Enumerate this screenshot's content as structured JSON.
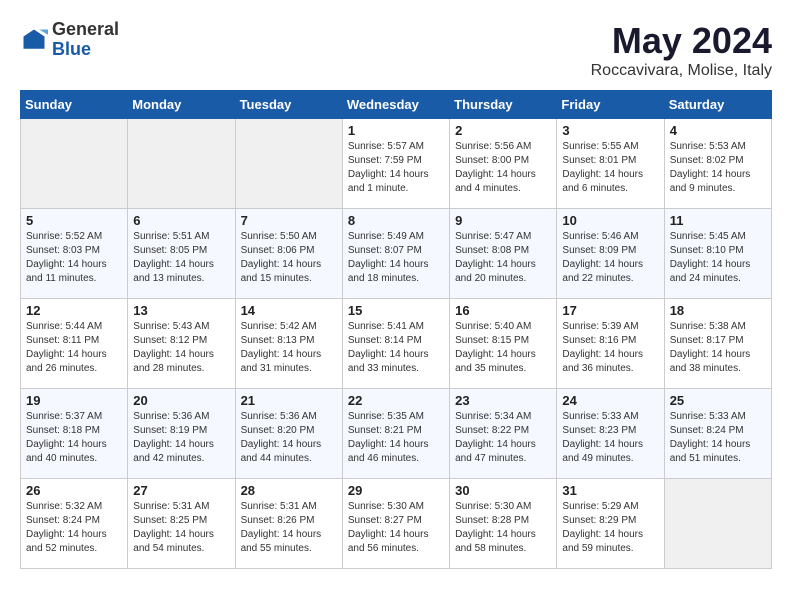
{
  "logo": {
    "general": "General",
    "blue": "Blue"
  },
  "title": "May 2024",
  "location": "Roccavivara, Molise, Italy",
  "days_header": [
    "Sunday",
    "Monday",
    "Tuesday",
    "Wednesday",
    "Thursday",
    "Friday",
    "Saturday"
  ],
  "weeks": [
    [
      {
        "day": "",
        "content": ""
      },
      {
        "day": "",
        "content": ""
      },
      {
        "day": "",
        "content": ""
      },
      {
        "day": "1",
        "content": "Sunrise: 5:57 AM\nSunset: 7:59 PM\nDaylight: 14 hours\nand 1 minute."
      },
      {
        "day": "2",
        "content": "Sunrise: 5:56 AM\nSunset: 8:00 PM\nDaylight: 14 hours\nand 4 minutes."
      },
      {
        "day": "3",
        "content": "Sunrise: 5:55 AM\nSunset: 8:01 PM\nDaylight: 14 hours\nand 6 minutes."
      },
      {
        "day": "4",
        "content": "Sunrise: 5:53 AM\nSunset: 8:02 PM\nDaylight: 14 hours\nand 9 minutes."
      }
    ],
    [
      {
        "day": "5",
        "content": "Sunrise: 5:52 AM\nSunset: 8:03 PM\nDaylight: 14 hours\nand 11 minutes."
      },
      {
        "day": "6",
        "content": "Sunrise: 5:51 AM\nSunset: 8:05 PM\nDaylight: 14 hours\nand 13 minutes."
      },
      {
        "day": "7",
        "content": "Sunrise: 5:50 AM\nSunset: 8:06 PM\nDaylight: 14 hours\nand 15 minutes."
      },
      {
        "day": "8",
        "content": "Sunrise: 5:49 AM\nSunset: 8:07 PM\nDaylight: 14 hours\nand 18 minutes."
      },
      {
        "day": "9",
        "content": "Sunrise: 5:47 AM\nSunset: 8:08 PM\nDaylight: 14 hours\nand 20 minutes."
      },
      {
        "day": "10",
        "content": "Sunrise: 5:46 AM\nSunset: 8:09 PM\nDaylight: 14 hours\nand 22 minutes."
      },
      {
        "day": "11",
        "content": "Sunrise: 5:45 AM\nSunset: 8:10 PM\nDaylight: 14 hours\nand 24 minutes."
      }
    ],
    [
      {
        "day": "12",
        "content": "Sunrise: 5:44 AM\nSunset: 8:11 PM\nDaylight: 14 hours\nand 26 minutes."
      },
      {
        "day": "13",
        "content": "Sunrise: 5:43 AM\nSunset: 8:12 PM\nDaylight: 14 hours\nand 28 minutes."
      },
      {
        "day": "14",
        "content": "Sunrise: 5:42 AM\nSunset: 8:13 PM\nDaylight: 14 hours\nand 31 minutes."
      },
      {
        "day": "15",
        "content": "Sunrise: 5:41 AM\nSunset: 8:14 PM\nDaylight: 14 hours\nand 33 minutes."
      },
      {
        "day": "16",
        "content": "Sunrise: 5:40 AM\nSunset: 8:15 PM\nDaylight: 14 hours\nand 35 minutes."
      },
      {
        "day": "17",
        "content": "Sunrise: 5:39 AM\nSunset: 8:16 PM\nDaylight: 14 hours\nand 36 minutes."
      },
      {
        "day": "18",
        "content": "Sunrise: 5:38 AM\nSunset: 8:17 PM\nDaylight: 14 hours\nand 38 minutes."
      }
    ],
    [
      {
        "day": "19",
        "content": "Sunrise: 5:37 AM\nSunset: 8:18 PM\nDaylight: 14 hours\nand 40 minutes."
      },
      {
        "day": "20",
        "content": "Sunrise: 5:36 AM\nSunset: 8:19 PM\nDaylight: 14 hours\nand 42 minutes."
      },
      {
        "day": "21",
        "content": "Sunrise: 5:36 AM\nSunset: 8:20 PM\nDaylight: 14 hours\nand 44 minutes."
      },
      {
        "day": "22",
        "content": "Sunrise: 5:35 AM\nSunset: 8:21 PM\nDaylight: 14 hours\nand 46 minutes."
      },
      {
        "day": "23",
        "content": "Sunrise: 5:34 AM\nSunset: 8:22 PM\nDaylight: 14 hours\nand 47 minutes."
      },
      {
        "day": "24",
        "content": "Sunrise: 5:33 AM\nSunset: 8:23 PM\nDaylight: 14 hours\nand 49 minutes."
      },
      {
        "day": "25",
        "content": "Sunrise: 5:33 AM\nSunset: 8:24 PM\nDaylight: 14 hours\nand 51 minutes."
      }
    ],
    [
      {
        "day": "26",
        "content": "Sunrise: 5:32 AM\nSunset: 8:24 PM\nDaylight: 14 hours\nand 52 minutes."
      },
      {
        "day": "27",
        "content": "Sunrise: 5:31 AM\nSunset: 8:25 PM\nDaylight: 14 hours\nand 54 minutes."
      },
      {
        "day": "28",
        "content": "Sunrise: 5:31 AM\nSunset: 8:26 PM\nDaylight: 14 hours\nand 55 minutes."
      },
      {
        "day": "29",
        "content": "Sunrise: 5:30 AM\nSunset: 8:27 PM\nDaylight: 14 hours\nand 56 minutes."
      },
      {
        "day": "30",
        "content": "Sunrise: 5:30 AM\nSunset: 8:28 PM\nDaylight: 14 hours\nand 58 minutes."
      },
      {
        "day": "31",
        "content": "Sunrise: 5:29 AM\nSunset: 8:29 PM\nDaylight: 14 hours\nand 59 minutes."
      },
      {
        "day": "",
        "content": ""
      }
    ]
  ]
}
